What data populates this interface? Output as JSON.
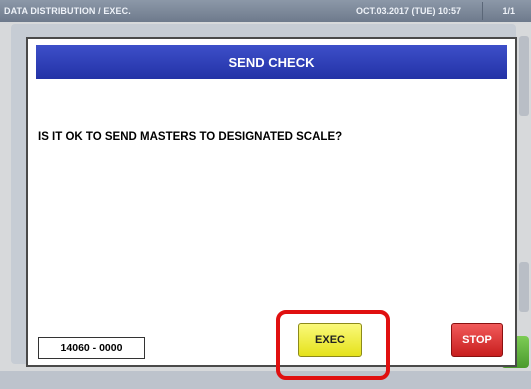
{
  "header": {
    "breadcrumb": "DATA DISTRIBUTION / EXEC.",
    "datetime": "OCT.03.2017 (TUE) 10:57",
    "page": "1/1"
  },
  "dialog": {
    "title": "SEND CHECK",
    "message": "IS IT OK TO SEND MASTERS TO DESIGNATED SCALE?",
    "code": "14060 - 0000",
    "exec_label": "EXEC",
    "stop_label": "STOP"
  },
  "colors": {
    "title_bar": "#2d3db8",
    "exec_button": "#f2f04a",
    "stop_button": "#e03a3a",
    "highlight": "#e01010"
  }
}
